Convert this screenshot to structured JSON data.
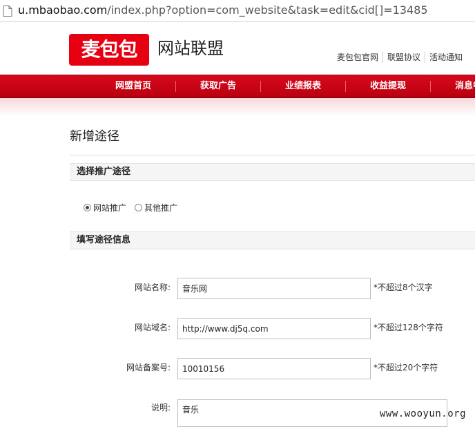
{
  "browser": {
    "url_domain": "u.mbaobao.com",
    "url_path": "/index.php?option=com_website&task=edit&cid[]=13485"
  },
  "header": {
    "logo_text": "麦包包",
    "site_name": "网站联盟",
    "links": [
      "麦包包官网",
      "联盟协议",
      "活动通知"
    ]
  },
  "nav": {
    "items": [
      "网盟首页",
      "获取广告",
      "业绩报表",
      "收益提现",
      "消息中心"
    ]
  },
  "page": {
    "title": "新增途径",
    "section_channel": "选择推广途径",
    "radio_website": "网站推广",
    "radio_other": "其他推广",
    "selected": "网站推广",
    "section_info": "填写途径信息"
  },
  "form": {
    "name_label": "网站名称:",
    "name_value": "音乐网",
    "name_hint": "*不超过8个汉字",
    "domain_label": "网站域名:",
    "domain_value": "http://www.dj5q.com",
    "domain_hint": "*不超过128个字符",
    "icp_label": "网站备案号:",
    "icp_value": "10010156",
    "icp_hint": "*不超过20个字符",
    "desc_label": "说明:",
    "desc_value": "音乐"
  },
  "watermark": "www.wooyun.org",
  "colors": {
    "nav_red": "#c8001a",
    "logo_red": "#e60012"
  },
  "icons": {
    "address_bar": "page-icon"
  }
}
